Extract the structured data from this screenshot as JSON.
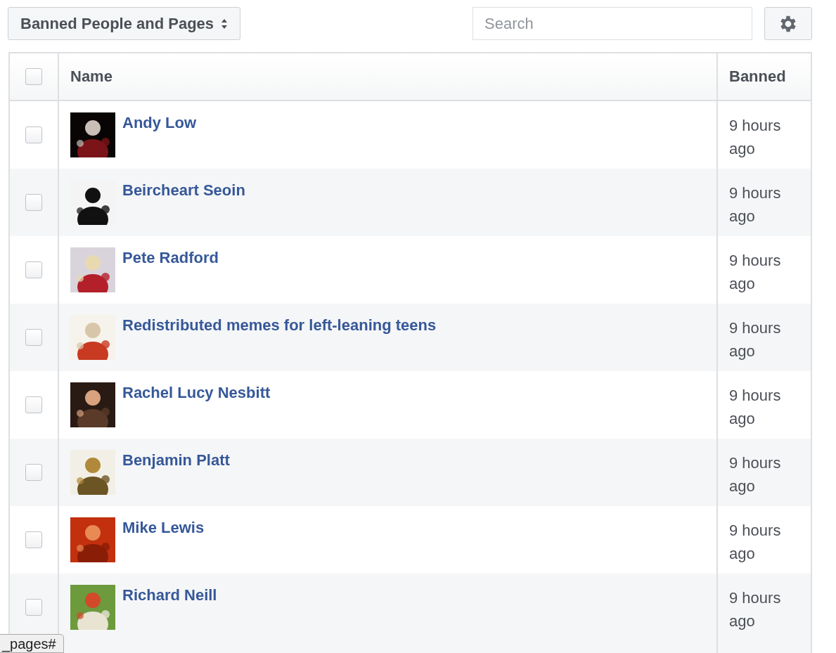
{
  "toolbar": {
    "list_selector": "Banned People and Pages",
    "search": {
      "placeholder": "Search"
    }
  },
  "table": {
    "select_all": {
      "checked": false
    },
    "columns": [
      "Name",
      "Banned"
    ],
    "rows": [
      {
        "name": "Andy Low",
        "banned": "9 hours ago",
        "checked": false
      },
      {
        "name": "Beircheart Seoin",
        "banned": "9 hours ago",
        "checked": false
      },
      {
        "name": "Pete Radford",
        "banned": "9 hours ago",
        "checked": false
      },
      {
        "name": "Redistributed memes for left-leaning teens",
        "banned": "9 hours ago",
        "checked": false
      },
      {
        "name": "Rachel Lucy Nesbitt",
        "banned": "9 hours ago",
        "checked": false
      },
      {
        "name": "Benjamin Platt",
        "banned": "9 hours ago",
        "checked": false
      },
      {
        "name": "Mike Lewis",
        "banned": "9 hours ago",
        "checked": false
      },
      {
        "name": "Richard Neill",
        "banned": "9 hours ago",
        "checked": false
      }
    ]
  },
  "status_url": "_pages#"
}
